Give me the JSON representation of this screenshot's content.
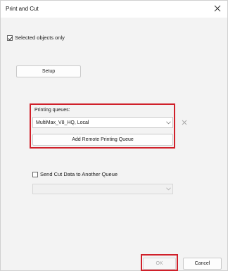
{
  "window": {
    "title": "Print and Cut"
  },
  "selected_only": {
    "label": "Selected objects only",
    "checked": true
  },
  "setup_button": {
    "label": "Setup"
  },
  "printing_queues": {
    "label": "Printing queues:",
    "selected_value": "MultiMax_V8_HQ, Local",
    "add_button_label": "Add Remote Printing Queue"
  },
  "send_cut": {
    "label": "Send Cut Data to Another Queue",
    "checked": false,
    "selected_value": ""
  },
  "footer": {
    "ok_label": "OK",
    "cancel_label": "Cancel"
  },
  "colors": {
    "highlight": "#d0202a",
    "background": "#f3f3f3"
  }
}
